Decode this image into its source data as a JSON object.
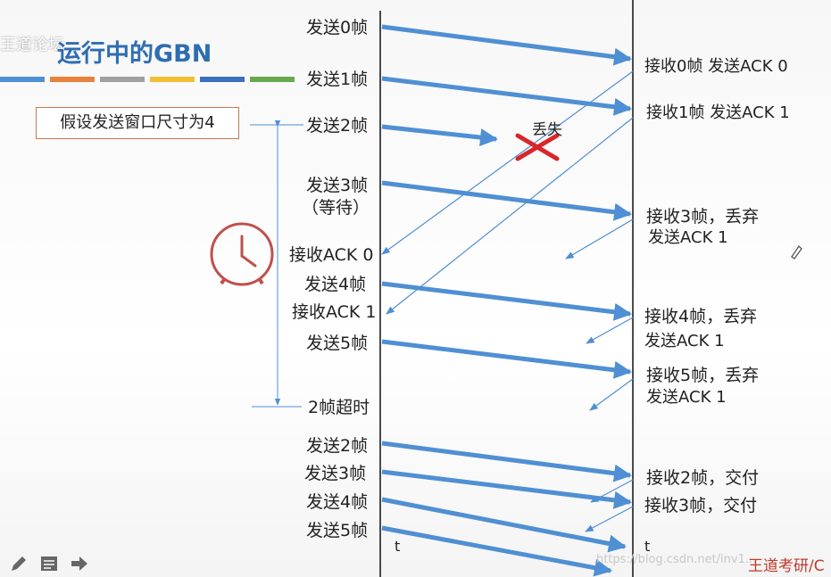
{
  "title": "运行中的GBN",
  "watermark": "王道论坛",
  "assumption": "假设发送窗口尺寸为4",
  "colors": {
    "accent": "#4f8fd3",
    "stripes": [
      "#4f8fd3",
      "#e8823a",
      "#a0a0a0",
      "#f2be33",
      "#3b6fbf",
      "#6aa84f"
    ],
    "clock": "#c0504d",
    "lost": "#d9262a"
  },
  "sender_labels": {
    "s0": "发送0帧",
    "s1": "发送1帧",
    "s2": "发送2帧",
    "s3": "发送3帧",
    "s3b": "（等待）",
    "r_ack0": "接收ACK 0",
    "s4": "发送4帧",
    "r_ack1": "接收ACK 1",
    "s5": "发送5帧",
    "timeout": "2帧超时",
    "rs2": "发送2帧",
    "rs3": "发送3帧",
    "rs4": "发送4帧",
    "rs5": "发送5帧",
    "t": "t"
  },
  "receiver_labels": {
    "r0": "接收0帧 发送ACK 0",
    "r1": "接收1帧 发送ACK 1",
    "r3a": "接收3帧，丢弃",
    "r3b": "发送ACK 1",
    "r4a": "接收4帧，丢弃",
    "r4b": "发送ACK 1",
    "r5a": "接收5帧，丢弃",
    "r5b": "发送ACK 1",
    "rr2": "接收2帧，交付",
    "rr3": "接收3帧，交付",
    "t": "t"
  },
  "lost_label": "丢失",
  "footer": "王道考研/C",
  "url_watermark": "https://blog.csdn.net/inv1...",
  "toolbar": {
    "icons": [
      "pencil-icon",
      "notes-icon",
      "arrow-right-icon"
    ]
  }
}
